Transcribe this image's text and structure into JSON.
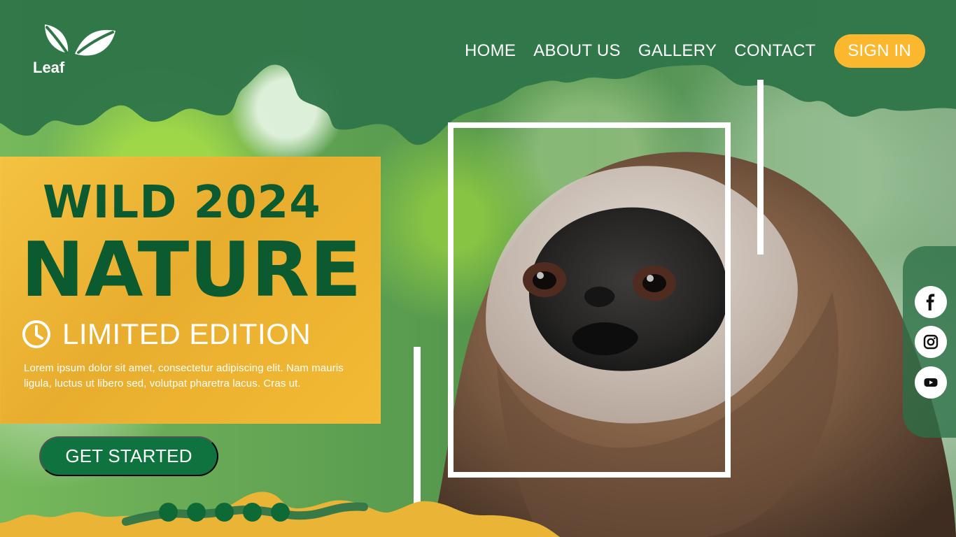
{
  "brand": {
    "logo_text": "Leaf",
    "logo_icon": "leaf-icon"
  },
  "navigation": {
    "items": [
      {
        "label": "HOME"
      },
      {
        "label": "ABOUT US"
      },
      {
        "label": "GALLERY"
      },
      {
        "label": "CONTACT"
      }
    ],
    "sign_in": "SIGN IN"
  },
  "hero": {
    "title_line_1": "WILD 2024",
    "title_line_2": "NATURE",
    "edition": "LIMITED EDITION",
    "edition_icon": "clock-icon",
    "description": "Lorem ipsum dolor sit amet, consectetur adipiscing elit. Nam mauris ligula, luctus ut libero sed, volutpat pharetra lacus. Cras ut.",
    "cta": "GET STARTED"
  },
  "carousel": {
    "indicator_count": 5
  },
  "social": [
    {
      "name": "facebook-icon"
    },
    {
      "name": "instagram-icon"
    },
    {
      "name": "youtube-icon"
    }
  ],
  "colors": {
    "primary_green": "#0c5a30",
    "accent_yellow": "#fbb82f",
    "white": "#ffffff"
  }
}
